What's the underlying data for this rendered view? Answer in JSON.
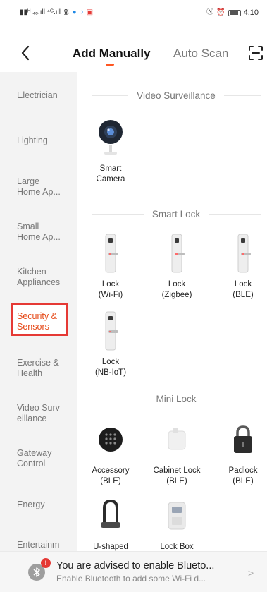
{
  "status_bar": {
    "time": "4:10",
    "left_text": "Ⓓᴴ ᴴᴰ .││ ⁴ᴳ.││"
  },
  "header": {
    "tab_add": "Add Manually",
    "tab_auto": "Auto Scan",
    "accent_color": "#ff5722"
  },
  "sidebar": {
    "items": [
      {
        "label": "Electrician"
      },
      {
        "label": "Lighting"
      },
      {
        "label": "Large\nHome Ap..."
      },
      {
        "label": "Small\nHome Ap..."
      },
      {
        "label": "Kitchen\nAppliances"
      },
      {
        "label": "Security &\nSensors",
        "active": true
      },
      {
        "label": "Exercise &\nHealth"
      },
      {
        "label": "Video Surv\neillance"
      },
      {
        "label": "Gateway\nControl"
      },
      {
        "label": "Energy"
      },
      {
        "label": "Entertainm"
      }
    ]
  },
  "sections": [
    {
      "title": "Video Surveillance",
      "devices": [
        {
          "label": "Smart\nCamera",
          "icon": "camera-icon"
        }
      ]
    },
    {
      "title": "Smart Lock",
      "devices": [
        {
          "label": "Lock\n(Wi-Fi)",
          "icon": "lock-icon"
        },
        {
          "label": "Lock\n(Zigbee)",
          "icon": "lock-icon"
        },
        {
          "label": "Lock\n(BLE)",
          "icon": "lock-icon"
        },
        {
          "label": "Lock\n(NB-IoT)",
          "icon": "lock-icon"
        }
      ]
    },
    {
      "title": "Mini Lock",
      "devices": [
        {
          "label": "Accessory\n(BLE)",
          "icon": "keypad-icon"
        },
        {
          "label": "Cabinet Lock\n(BLE)",
          "icon": "cabinet-lock-icon"
        },
        {
          "label": "Padlock\n(BLE)",
          "icon": "padlock-icon"
        },
        {
          "label": "U-shaped",
          "icon": "u-lock-icon"
        },
        {
          "label": "Lock Box",
          "icon": "lock-box-icon"
        }
      ]
    }
  ],
  "banner": {
    "title": "You are advised to enable Blueto...",
    "subtitle": "Enable Bluetooth to add some Wi-Fi d...",
    "badge": "!"
  }
}
